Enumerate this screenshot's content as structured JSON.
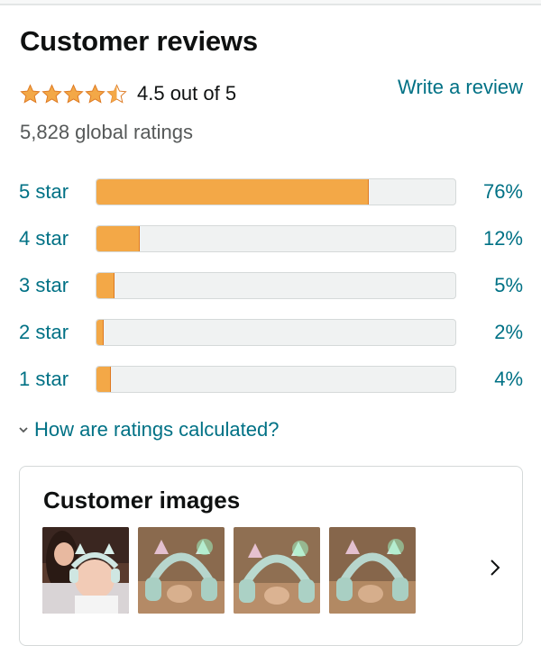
{
  "reviews": {
    "title": "Customer reviews",
    "rating_value": 4.5,
    "rating_text": "4.5 out of 5",
    "global_ratings": "5,828 global ratings",
    "write_review": "Write a review",
    "accent_colors": {
      "link": "#007185",
      "bar_fill": "#f3a847",
      "star": "#f3a847"
    }
  },
  "histogram": [
    {
      "label": "5 star",
      "percent_text": "76%",
      "percent": 76
    },
    {
      "label": "4 star",
      "percent_text": "12%",
      "percent": 12
    },
    {
      "label": "3 star",
      "percent_text": "5%",
      "percent": 5
    },
    {
      "label": "2 star",
      "percent_text": "2%",
      "percent": 2
    },
    {
      "label": "1 star",
      "percent_text": "4%",
      "percent": 4
    }
  ],
  "calc_link": "How are ratings calculated?",
  "images_card": {
    "title": "Customer images",
    "thumbnails": [
      {
        "icon": "photo-mom-and-baby"
      },
      {
        "icon": "photo-cat-ear-headphones"
      },
      {
        "icon": "photo-cat-ear-headphones"
      },
      {
        "icon": "photo-cat-ear-headphones"
      }
    ],
    "next_icon": "chevron-right-icon"
  }
}
